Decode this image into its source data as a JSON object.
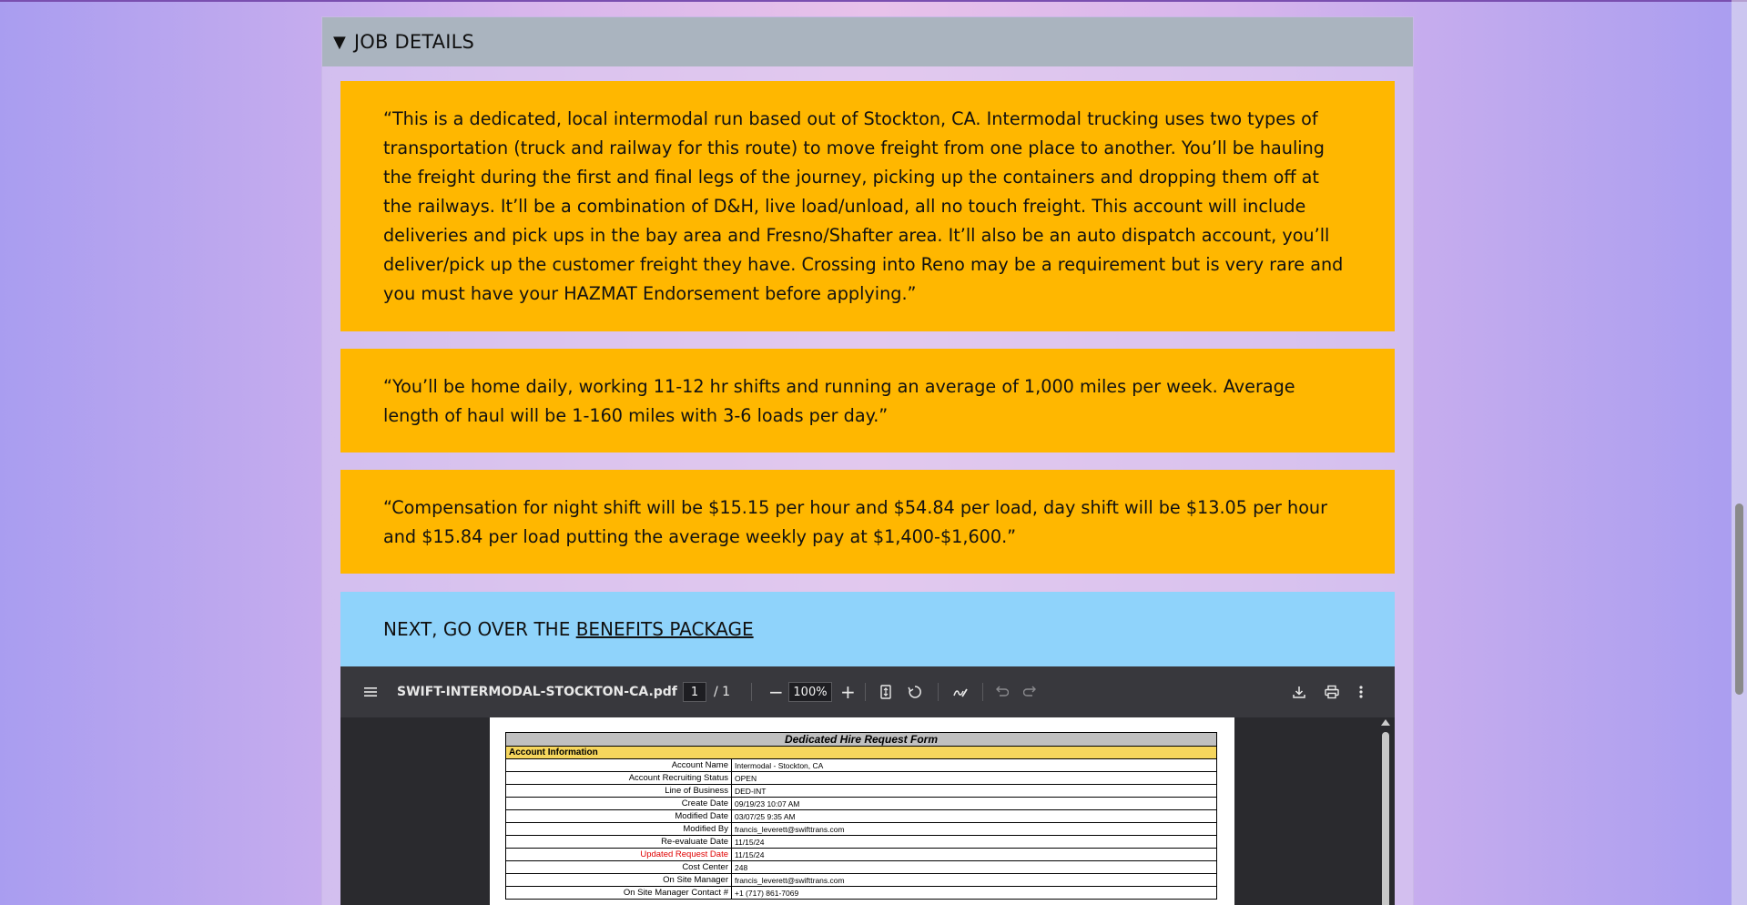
{
  "section": {
    "title": "JOB DETAILS",
    "toggle_icon": "triangle-down-icon"
  },
  "quotes": [
    "“This is a dedicated, local intermodal run based out of Stockton, CA. Intermodal trucking uses two types of transportation (truck and railway for this route) to move freight from one place to another. You’ll be hauling the freight during the first and final legs of the journey, picking up the containers and dropping them off at the railways. It’ll be a combination of D&H, live load/unload, all no touch freight. This account will include deliveries and pick ups in the bay area and Fresno/Shafter area. It’ll also be an auto dispatch account, you’ll deliver/pick up the customer freight they have. Crossing into Reno may be a requirement but is very rare and you must have your HAZMAT Endorsement before applying.”",
    "“You’ll be home daily, working 11-12 hr shifts and running an average of 1,000 miles per week. Average length of haul will be 1-160 miles with 3-6 loads per day.”",
    "“Compensation for night shift will be $15.15 per hour and $54.84 per load, day shift will be $13.05 per hour and $15.84 per load putting the average weekly pay at $1,400-$1,600.”"
  ],
  "next": {
    "prefix": "NEXT, GO OVER THE ",
    "link": "BENEFITS PACKAGE"
  },
  "pdf_viewer": {
    "filename": "SWIFT-INTERMODAL-STOCKTON-CA.pdf",
    "current_page": "1",
    "total_pages": "/ 1",
    "zoom": "100%"
  },
  "form": {
    "title": "Dedicated Hire Request Form",
    "section": "Account Information",
    "rows": [
      {
        "label": "Account Name",
        "value": "Intermodal - Stockton, CA",
        "highlight": false
      },
      {
        "label": "Account Recruiting Status",
        "value": "OPEN",
        "highlight": false
      },
      {
        "label": "Line of Business",
        "value": "DED-INT",
        "highlight": false
      },
      {
        "label": "Create Date",
        "value": "09/19/23 10:07 AM",
        "highlight": false
      },
      {
        "label": "Modified Date",
        "value": "03/07/25 9:35 AM",
        "highlight": false
      },
      {
        "label": "Modified By",
        "value": "francis_leverett@swifttrans.com",
        "highlight": false
      },
      {
        "label": "Re-evaluate Date",
        "value": "11/15/24",
        "highlight": false
      },
      {
        "label": "Updated Request Date",
        "value": "11/15/24",
        "highlight": true
      },
      {
        "label": "Cost Center",
        "value": "248",
        "highlight": false
      },
      {
        "label": "On Site Manager",
        "value": "francis_leverett@swifttrans.com",
        "highlight": false
      },
      {
        "label": "On Site Manager Contact #",
        "value": "+1 (717) 861-7069",
        "highlight": false
      }
    ]
  },
  "colors": {
    "quote_bg": "#ffb700",
    "next_bg": "#8fd3fb",
    "header_bg": "#aab4bf",
    "form_section": "#f6d65d",
    "highlight_label": "#e00000"
  }
}
